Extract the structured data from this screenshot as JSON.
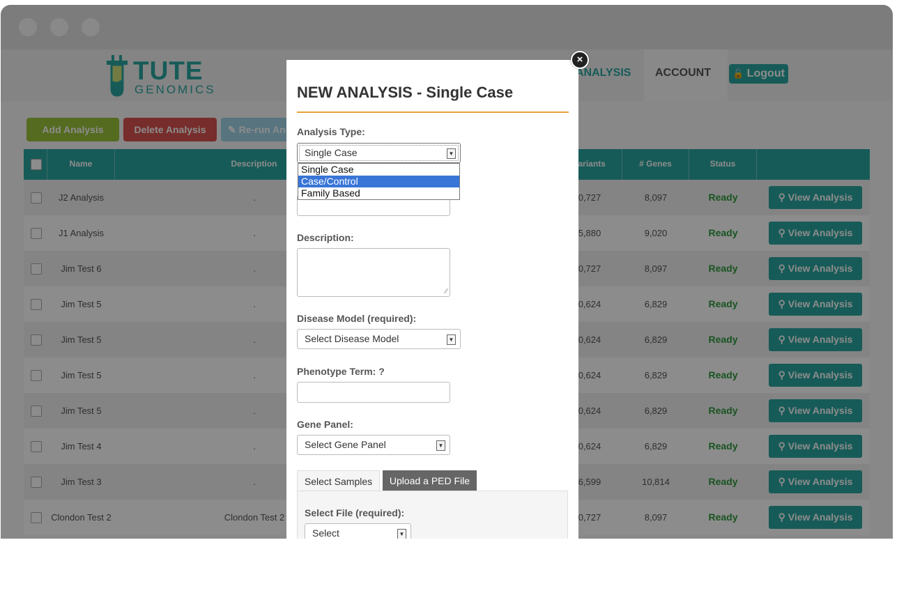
{
  "colors": {
    "teal": "#2aa7a0",
    "green_btn": "#9cc33b",
    "red_btn": "#d9534f",
    "light_btn": "#9fd3e8",
    "ready_green": "#2f9a3c",
    "rule_orange": "#e8a23a",
    "select_blue": "#3875d7"
  },
  "logo": {
    "line1": "TUTE",
    "line2": "GENOMICS"
  },
  "nav": {
    "analysis": "ANALYSIS",
    "account": "ACCOUNT",
    "logout": "Logout",
    "lock_icon": "lock-icon"
  },
  "toolbar": {
    "add": "Add Analysis",
    "delete": "Delete Analysis",
    "rerun": "Re-run An"
  },
  "table": {
    "headers": {
      "name": "Name",
      "description": "Description",
      "variants": "Variants",
      "genes": "# Genes",
      "status": "Status"
    },
    "view_label": "View Analysis",
    "rows": [
      {
        "name": "J2 Analysis",
        "description": ".",
        "variants": "0,727",
        "genes": "8,097",
        "status": "Ready"
      },
      {
        "name": "J1 Analysis",
        "description": ".",
        "variants": "5,880",
        "genes": "9,020",
        "status": "Ready"
      },
      {
        "name": "Jim Test 6",
        "description": ".",
        "variants": "0,727",
        "genes": "8,097",
        "status": "Ready"
      },
      {
        "name": "Jim Test 5",
        "description": ".",
        "variants": "0,624",
        "genes": "6,829",
        "status": "Ready"
      },
      {
        "name": "Jim Test 5",
        "description": ".",
        "variants": "0,624",
        "genes": "6,829",
        "status": "Ready"
      },
      {
        "name": "Jim Test 5",
        "description": ".",
        "variants": "0,624",
        "genes": "6,829",
        "status": "Ready"
      },
      {
        "name": "Jim Test 5",
        "description": ".",
        "variants": "0,624",
        "genes": "6,829",
        "status": "Ready"
      },
      {
        "name": "Jim Test 4",
        "description": ".",
        "variants": "0,624",
        "genes": "6,829",
        "status": "Ready"
      },
      {
        "name": "Jim Test 3",
        "description": ".",
        "variants": "6,599",
        "genes": "10,814",
        "status": "Ready"
      },
      {
        "name": "Clondon Test 2",
        "description": "Clondon Test 2",
        "variants": "0,727",
        "genes": "8,097",
        "status": "Ready"
      }
    ]
  },
  "modal": {
    "title": "NEW ANALYSIS - Single Case",
    "analysis_type_label": "Analysis Type:",
    "analysis_type_value": "Single Case",
    "analysis_type_options": [
      "Single Case",
      "Case/Control",
      "Family Based"
    ],
    "description_label": "Description:",
    "disease_model_label": "Disease Model (required):",
    "disease_model_value": "Select Disease Model",
    "phenotype_label": "Phenotype Term: ?",
    "gene_panel_label": "Gene Panel:",
    "gene_panel_value": "Select Gene Panel",
    "tabs": [
      "Select Samples",
      "Upload a PED File"
    ],
    "select_file_label": "Select File (required):",
    "select_file_value": "Select"
  }
}
